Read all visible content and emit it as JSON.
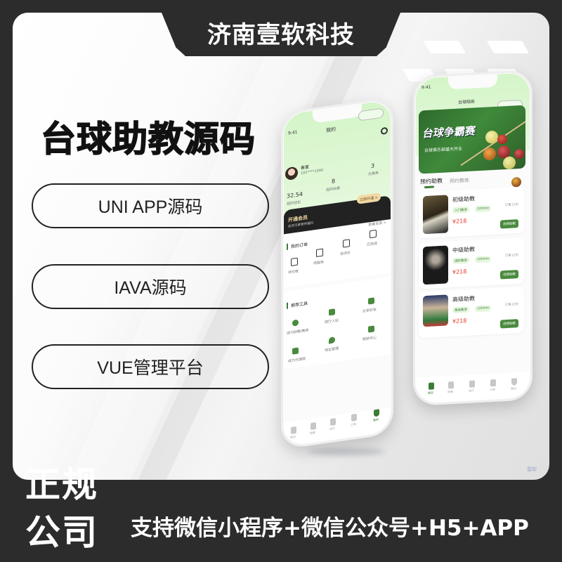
{
  "brand": {
    "company_name": "济南壹软科技"
  },
  "hero": {
    "title": "台球助教源码"
  },
  "features": [
    {
      "label": "UNI APP源码"
    },
    {
      "label": "IAVA源码"
    },
    {
      "label": "VUE管理平台"
    }
  ],
  "footer": {
    "badge_line1": "正规",
    "badge_line2": "公司",
    "tagline": "支持微信小程序+微信公众号+H5+APP"
  },
  "watermark": "壹软",
  "phone_left": {
    "status_time": "9:41",
    "page_title": "我的",
    "user": {
      "name": "春夏",
      "phone": "182****1990"
    },
    "stats": [
      {
        "value": "32.54",
        "label": "我的钱包"
      },
      {
        "value": "8",
        "label": "我的收藏"
      },
      {
        "value": "3",
        "label": "优惠券"
      }
    ],
    "vip": {
      "title": "开通会员",
      "subtitle": "会员可享更持福利",
      "button": "立即开通 >"
    },
    "view_all": "查看全部 >",
    "orders": {
      "title": "我的订单",
      "items": [
        {
          "label": "待付款",
          "icon": "wallet-icon"
        },
        {
          "label": "待服务",
          "icon": "box-icon"
        },
        {
          "label": "待评价",
          "icon": "comment-icon"
        },
        {
          "label": "已完成",
          "icon": "check-doc-icon"
        }
      ]
    },
    "tools": {
      "title": "推荐工具",
      "items": [
        {
          "label": "成为助教/教练",
          "icon": "person-icon"
        },
        {
          "label": "球厅入驻",
          "icon": "store-icon"
        },
        {
          "label": "分享好友",
          "icon": "share-icon"
        },
        {
          "label": "成为代理商",
          "icon": "agent-icon"
        },
        {
          "label": "地址管理",
          "icon": "location-icon"
        },
        {
          "label": "帮助中心",
          "icon": "help-icon"
        }
      ]
    },
    "tabbar": [
      {
        "label": "首页",
        "icon": "home-icon",
        "active": false
      },
      {
        "label": "助教",
        "icon": "coach-icon",
        "active": false
      },
      {
        "label": "球厅",
        "icon": "hall-icon",
        "active": false
      },
      {
        "label": "订单",
        "icon": "order-icon",
        "active": false
      },
      {
        "label": "我的",
        "icon": "user-icon",
        "active": true
      }
    ]
  },
  "phone_right": {
    "status_time": "9:41",
    "page_title": "台球陪练",
    "banner": {
      "title": "台球争霸赛",
      "subtitle": "台球俱乐部盛大开业"
    },
    "segments": {
      "active": "预约助教",
      "inactive": "预约教练"
    },
    "coaches": [
      {
        "name": "初级助教",
        "tag": "入门教学",
        "duration": "120min",
        "price": "¥218",
        "sold": "已售12份",
        "button": "选择助教"
      },
      {
        "name": "中级助教",
        "tag": "进阶教学",
        "duration": "120min",
        "price": "¥218",
        "sold": "已售12份",
        "button": "选择助教"
      },
      {
        "name": "高级助教",
        "tag": "高级教学",
        "duration": "120min",
        "price": "¥218",
        "sold": "已售12份",
        "button": "选择助教"
      }
    ],
    "tabbar": [
      {
        "label": "首页",
        "icon": "home-icon",
        "active": true
      },
      {
        "label": "助教",
        "icon": "coach-icon",
        "active": false
      },
      {
        "label": "球厅",
        "icon": "hall-icon",
        "active": false
      },
      {
        "label": "订单",
        "icon": "order-icon",
        "active": false
      },
      {
        "label": "我的",
        "icon": "user-icon",
        "active": false
      }
    ]
  },
  "colors": {
    "dark_frame": "#2c2c2c",
    "accent_green": "#3d7c37",
    "price_red": "#e63b2e",
    "vip_gold": "#f0d9a4"
  }
}
